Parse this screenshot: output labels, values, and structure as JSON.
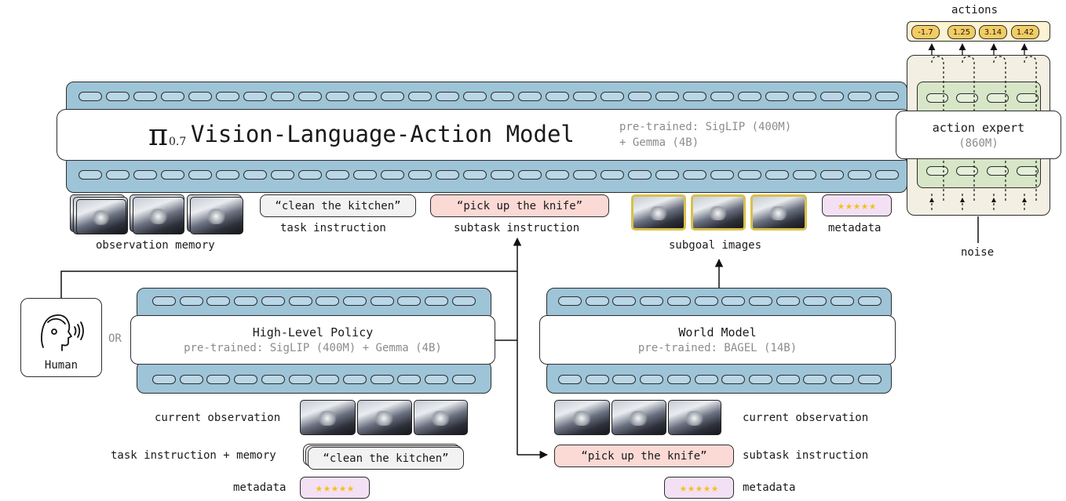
{
  "vla": {
    "pi_symbol": "π",
    "pi_subscript": "0.7",
    "title": "Vision-Language-Action Model",
    "pretrained_line1": "pre-trained: SigLIP (400M)",
    "pretrained_line2": "+ Gemma (4B)"
  },
  "action_expert": {
    "title": "action expert",
    "size": "(860M)",
    "actions_label": "actions",
    "action_values": [
      "-1.7",
      "1.25",
      "3.14",
      "1.42"
    ],
    "noise_label": "noise"
  },
  "inputs": {
    "observation_memory": "observation memory",
    "task_quote": "“clean the kitchen”",
    "task_label": "task instruction",
    "subtask_quote": "“pick up the knife”",
    "subtask_label": "subtask instruction",
    "subgoal_label": "subgoal images",
    "metadata_label": "metadata"
  },
  "human": {
    "label": "Human",
    "or": "OR"
  },
  "high_level_policy": {
    "title": "High-Level Policy",
    "pretrained": "pre-trained: SigLIP (400M) + Gemma (4B)",
    "current_observation": "current observation",
    "task_memory_label": "task instruction + memory",
    "task_quote": "“clean the kitchen”",
    "metadata_label": "metadata"
  },
  "world_model": {
    "title": "World Model",
    "pretrained": "pre-trained: BAGEL (14B)",
    "current_observation": "current observation",
    "subtask_quote": "“pick up the knife”",
    "subtask_label": "subtask instruction",
    "metadata_label": "metadata"
  },
  "colors": {
    "band_blue": "#9ec4d8",
    "expert_green": "#d6e6c7",
    "expert_bg": "#f3efe2",
    "subtask_pink": "#fbd9d5",
    "meta_purple": "#f3e0f5",
    "value_gold": "#f3cc64"
  },
  "icons": [
    "human-speaking-icon",
    "star-icon",
    "arrow-icon"
  ]
}
